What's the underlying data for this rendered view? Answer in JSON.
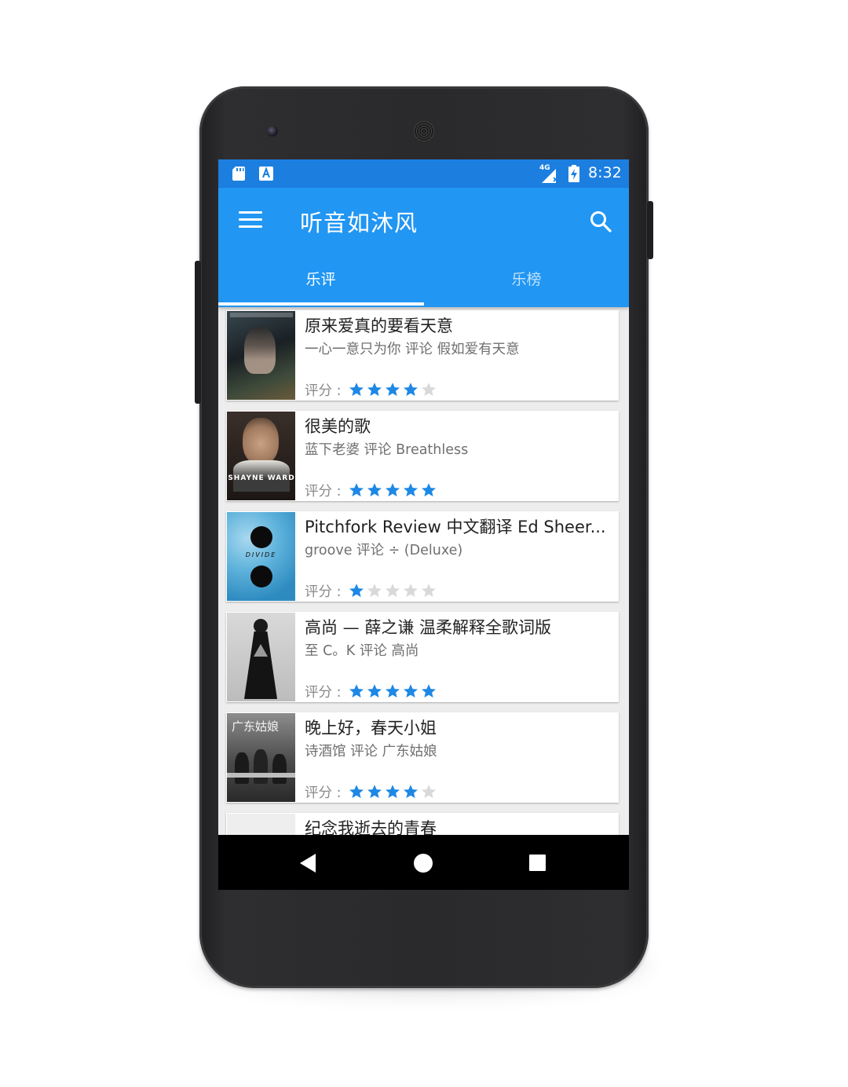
{
  "app": {
    "title": "听音如沐风"
  },
  "status_bar": {
    "time": "8:32",
    "network": "4G",
    "icons": [
      "sd-card-icon",
      "keyboard-a-icon",
      "signal-icon",
      "battery-charging-icon"
    ]
  },
  "tabs": [
    {
      "label": "乐评",
      "active": true
    },
    {
      "label": "乐榜",
      "active": false
    }
  ],
  "rating_label": "评分 :",
  "reviews": [
    {
      "title": "原来爱真的要看天意",
      "subtitle": "一心一意只为你 评论 假如爱有天意",
      "rating": 4
    },
    {
      "title": "很美的歌",
      "subtitle": "蓝下老婆 评论 Breathless",
      "rating": 5,
      "cover_text": "SHAYNE WARD"
    },
    {
      "title": "Pitchfork Review 中文翻译 Ed Sheer...",
      "subtitle": "groove 评论 ÷ (Deluxe)",
      "rating": 1,
      "cover_text": "DIVIDE"
    },
    {
      "title": "高尚 — 薛之谦 温柔解释全歌词版",
      "subtitle": "至 C。K 评论 高尚",
      "rating": 5
    },
    {
      "title": "晚上好，春天小姐",
      "subtitle": "诗酒馆 评论 广东姑娘",
      "rating": 4,
      "cover_text": "广东姑娘"
    },
    {
      "title": "纪念我逝去的青春",
      "subtitle": "",
      "rating": 0
    }
  ],
  "max_rating": 5,
  "colors": {
    "primary": "#2196f3",
    "status_bar": "#1c7fe0",
    "star_on": "#1e88e5",
    "star_off": "#d9d9d9"
  },
  "nav": {
    "icons": [
      "back-icon",
      "home-icon",
      "recents-icon"
    ]
  }
}
